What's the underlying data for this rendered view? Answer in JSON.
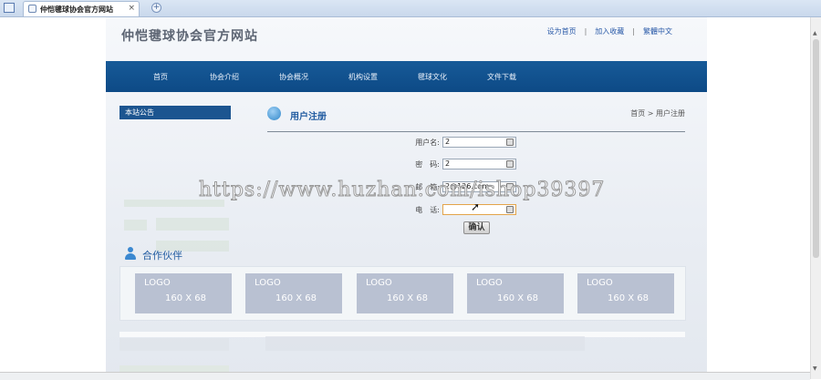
{
  "browser": {
    "tab_title": "仲恺毽球协会官方网站",
    "close_glyph": "×",
    "new_tab_glyph": "+"
  },
  "header": {
    "site_title": "仲恺毽球协会官方网站",
    "links": [
      "设为首页",
      "加入收藏",
      "繁體中文"
    ],
    "separator": "|"
  },
  "nav": {
    "items": [
      "首页",
      "协会介绍",
      "协会概况",
      "机构设置",
      "毽球文化",
      "文件下载"
    ]
  },
  "sidebar": {
    "notice_title": "本站公告"
  },
  "content": {
    "title": "用户注册",
    "breadcrumb": "首页 > 用户注册"
  },
  "form": {
    "fields": [
      {
        "label": "用户名:",
        "value": "2"
      },
      {
        "label": "密　码:",
        "value": "2"
      },
      {
        "label": "邮　箱:",
        "value": "2@126.com"
      },
      {
        "label": "电　话:",
        "value": ""
      }
    ],
    "submit_label": "确认"
  },
  "partners": {
    "title": "合作伙伴",
    "logos": [
      {
        "text": "LOGO",
        "size": "160 X 68"
      },
      {
        "text": "LOGO",
        "size": "160 X 68"
      },
      {
        "text": "LOGO",
        "size": "160 X 68"
      },
      {
        "text": "LOGO",
        "size": "160 X 68"
      },
      {
        "text": "LOGO",
        "size": "160 X 68"
      }
    ]
  },
  "watermark": "https://www.huzhan.com/ishop39397",
  "colors": {
    "nav_bg": "#0d4a86",
    "title_blue": "#1f5aa0",
    "link_blue": "#2a5aa8",
    "logo_placeholder": "#b9c1d2"
  }
}
